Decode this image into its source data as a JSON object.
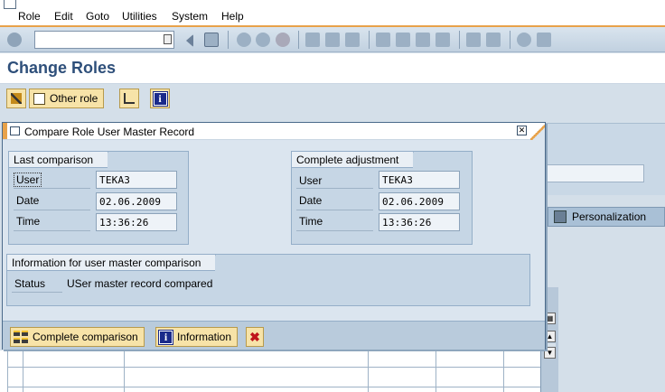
{
  "menu": {
    "items": [
      {
        "label": "Role"
      },
      {
        "label": "Edit"
      },
      {
        "label": "Goto"
      },
      {
        "label": "Utilities"
      },
      {
        "label": "System"
      },
      {
        "label": "Help"
      }
    ]
  },
  "standard_toolbar": {
    "command_field_value": "",
    "icons": [
      "enter-icon",
      "back-icon",
      "save-icon",
      "back-nav-icon",
      "exit-icon",
      "cancel-icon",
      "print-icon",
      "find-icon",
      "find-next-icon",
      "first-page-icon",
      "previous-page-icon",
      "next-page-icon",
      "last-page-icon",
      "create-session-icon",
      "shortcut-icon",
      "help-icon",
      "layout-menu-icon"
    ]
  },
  "page": {
    "title": "Change Roles"
  },
  "app_toolbar": {
    "other_role_label": "Other role"
  },
  "background": {
    "personalization_tab": "Personalization"
  },
  "dialog": {
    "title": "Compare Role User Master Record",
    "last_comparison": {
      "heading": "Last comparison",
      "user_label": "User",
      "user_value": "TEKA3",
      "date_label": "Date",
      "date_value": "02.06.2009",
      "time_label": "Time",
      "time_value": "13:36:26"
    },
    "complete_adjustment": {
      "heading": "Complete adjustment",
      "user_label": "User",
      "user_value": "TEKA3",
      "date_label": "Date",
      "date_value": "02.06.2009",
      "time_label": "Time",
      "time_value": "13:36:26"
    },
    "info": {
      "heading": "Information for user master comparison",
      "status_label": "Status",
      "status_value": "USer master record compared"
    },
    "footer": {
      "complete_comparison_label": "Complete comparison",
      "information_label": "Information",
      "cancel_symbol": "✖"
    }
  },
  "colors": {
    "accent_orange": "#e8a24a",
    "title_blue": "#2e4f7a",
    "button_yellow": "#f7e3a8",
    "background": "#d4dfe9"
  }
}
